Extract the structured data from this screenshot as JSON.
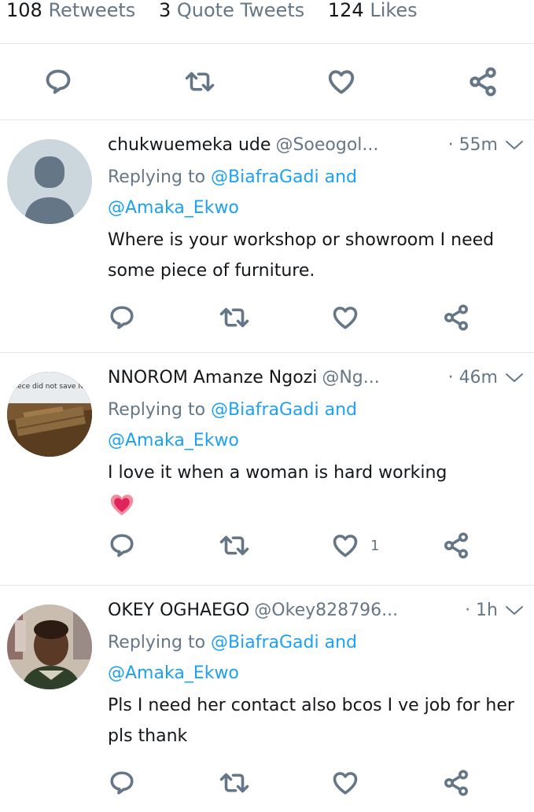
{
  "stats": {
    "retweets_count": "108",
    "retweets_label": "Retweets",
    "quotes_count": "3",
    "quotes_label": "Quote Tweets",
    "likes_count": "124",
    "likes_label": "Likes"
  },
  "top_actions": [
    "reply-icon",
    "retweet-icon",
    "like-icon",
    "share-icon"
  ],
  "tweets": [
    {
      "name": "chukwuemeka ude",
      "handle": "@Soeogol...",
      "time": "· 55m",
      "replying_prefix": "Replying to",
      "mention1": "@BiafraGadi",
      "and": "and",
      "mention2": "@Amaka_Ekwo",
      "text": "Where is your workshop or showroom I need some piece of furniture.",
      "like_count": ""
    },
    {
      "name": "NNOROM Amanze Ngozi",
      "handle": "@Ng...",
      "time": "· 46m",
      "replying_prefix": "Replying to",
      "mention1": "@BiafraGadi",
      "and": "and",
      "mention2": "@Amaka_Ekwo",
      "text": "I love it when a woman is hard working",
      "emoji": "💗",
      "like_count": "1",
      "avatar_caption": "Piece did not save No"
    },
    {
      "name": "OKEY OGHAEGO",
      "handle": "@Okey828796...",
      "time": "· 1h",
      "replying_prefix": "Replying to",
      "mention1": "@BiafraGadi",
      "and": "and",
      "mention2": "@Amaka_Ekwo",
      "text": "Pls I need her contact also bcos I ve  job for her pls thank",
      "like_count": ""
    }
  ],
  "colors": {
    "text": "#14171a",
    "secondary": "#657786",
    "accent": "#1da1f2",
    "divider": "#e1e8ed"
  }
}
